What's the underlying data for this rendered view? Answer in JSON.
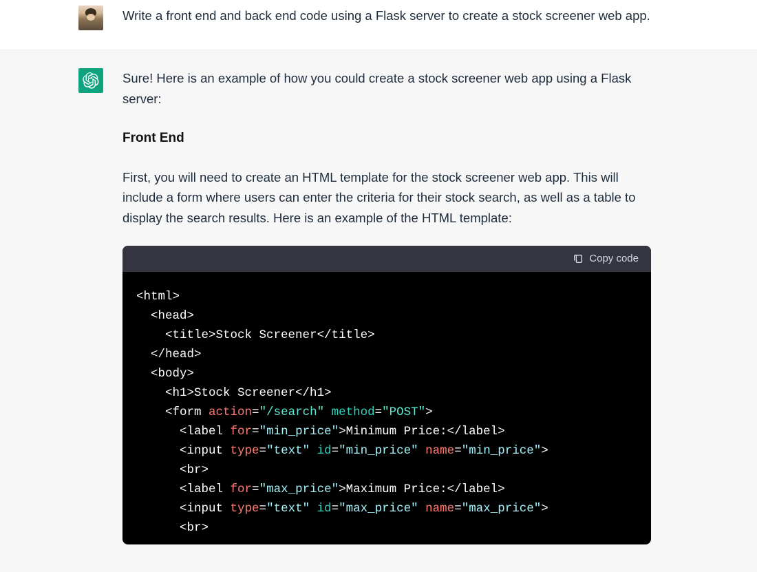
{
  "user": {
    "message": "Write a front end and back end code using a Flask server to create a stock screener web app."
  },
  "assistant": {
    "intro": "Sure! Here is an example of how you could create a stock screener web app using a Flask server:",
    "heading_front_end": "Front End",
    "front_end_desc": "First, you will need to create an HTML template for the stock screener web app. This will include a form where users can enter the criteria for their stock search, as well as a table to display the search results. Here is an example of the HTML template:"
  },
  "code_header": {
    "copy_label": "Copy code"
  },
  "code": {
    "l01_open_html": "<html>",
    "l02_open_head": "  <head>",
    "l03_title_open": "    <title>",
    "l03_title_text": "Stock Screener",
    "l03_title_close": "</title>",
    "l04_close_head": "  </head>",
    "l05_open_body": "  <body>",
    "l06_h1_open": "    <h1>",
    "l06_h1_text": "Stock Screener",
    "l06_h1_close": "</h1>",
    "l07_form_open": "    <form ",
    "l07_attr_action": "action",
    "l07_eq": "=",
    "l07_action_val": "\"/search\"",
    "l07_space": " ",
    "l07_attr_method": "method",
    "l07_method_val": "\"POST\"",
    "l07_form_close": ">",
    "l08_label_open": "      <label ",
    "l08_for": "for",
    "l08_for_val": "\"min_price\"",
    "l08_label_close": ">",
    "l08_label_text": "Minimum Price:",
    "l08_label_end": "</label>",
    "l09_input_open": "      <input ",
    "l09_type": "type",
    "l09_type_val": "\"text\"",
    "l09_id": "id",
    "l09_id_val": "\"min_price\"",
    "l09_name": "name",
    "l09_name_val": "\"min_price\"",
    "l09_input_close": ">",
    "l10_br": "      <br>",
    "l11_label_open": "      <label ",
    "l11_for": "for",
    "l11_for_val": "\"max_price\"",
    "l11_label_close": ">",
    "l11_label_text": "Maximum Price:",
    "l11_label_end": "</label>",
    "l12_input_open": "      <input ",
    "l12_type": "type",
    "l12_type_val": "\"text\"",
    "l12_id": "id",
    "l12_id_val": "\"max_price\"",
    "l12_name": "name",
    "l12_name_val": "\"max_price\"",
    "l12_input_close": ">",
    "l13_br": "      <br>"
  }
}
